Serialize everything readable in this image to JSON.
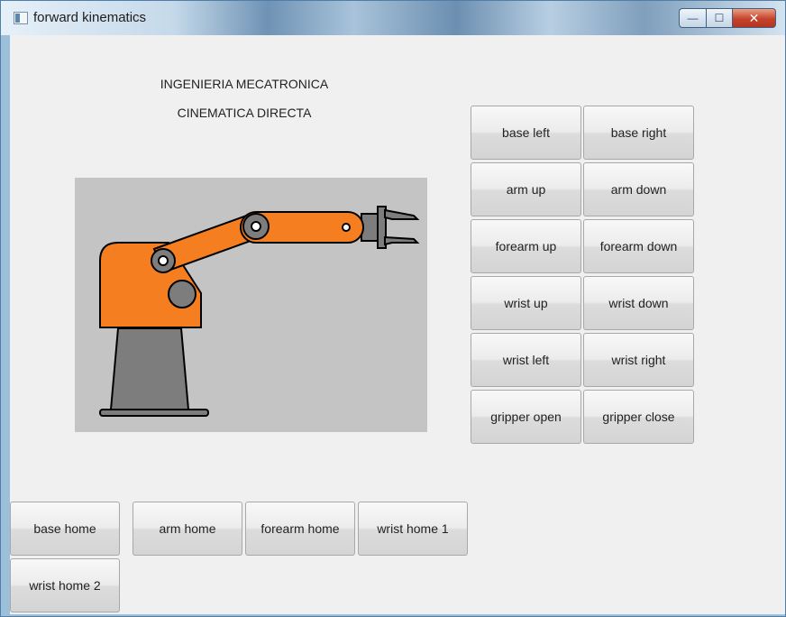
{
  "window": {
    "title": "forward kinematics",
    "controls": {
      "minimize": "—",
      "maximize": "☐",
      "close": "✕"
    }
  },
  "headings": {
    "line1": "INGENIERIA MECATRONICA",
    "line2": "CINEMATICA DIRECTA"
  },
  "robot": {
    "canvas_color": "#c4c4c4",
    "body_color": "#f57e20",
    "base_color": "#7d7d7d",
    "gripper_color": "#7d7d7d"
  },
  "controls": [
    {
      "left": "base left",
      "right": "base right"
    },
    {
      "left": "arm up",
      "right": "arm down"
    },
    {
      "left": "forearm up",
      "right": "forearm down"
    },
    {
      "left": "wrist up",
      "right": "wrist down"
    },
    {
      "left": "wrist left",
      "right": "wrist right"
    },
    {
      "left": "gripper open",
      "right": "gripper close"
    }
  ],
  "home_buttons": [
    "base home",
    "arm home",
    "forearm home",
    "wrist home 1",
    "wrist home 2"
  ]
}
